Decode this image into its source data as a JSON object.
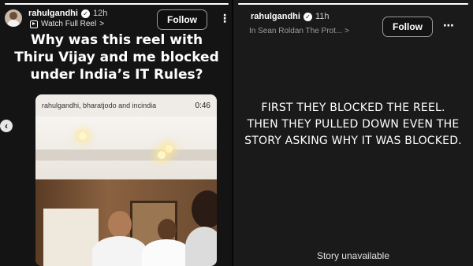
{
  "left_story": {
    "username": "rahulgandhi",
    "time": "12h",
    "sub_label": "Watch Full Reel",
    "sub_chevron": ">",
    "follow_label": "Follow",
    "more_label": "⋮",
    "headline_lines": [
      "Why was this reel with",
      "Thiru Vijay and me blocked",
      "under India’s IT Rules?"
    ],
    "card": {
      "header_text": "rahulgandhi, bharatjodo and incindia",
      "duration": "0:46"
    },
    "nav_prev": "‹"
  },
  "right_story": {
    "username": "rahulgandhi",
    "time": "11h",
    "overlap_text": "In  Sean Roldan  The Prot...  >",
    "follow_label": "Follow",
    "more_label": "⋯",
    "message_lines": [
      "FIRST THEY BLOCKED THE REEL.",
      "THEN THEY PULLED DOWN EVEN THE",
      "STORY ASKING WHY IT WAS BLOCKED."
    ],
    "status": "Story unavailable"
  },
  "colors": {
    "background_left": "#141414",
    "background_right": "#1a1a1a",
    "text": "#ffffff"
  }
}
